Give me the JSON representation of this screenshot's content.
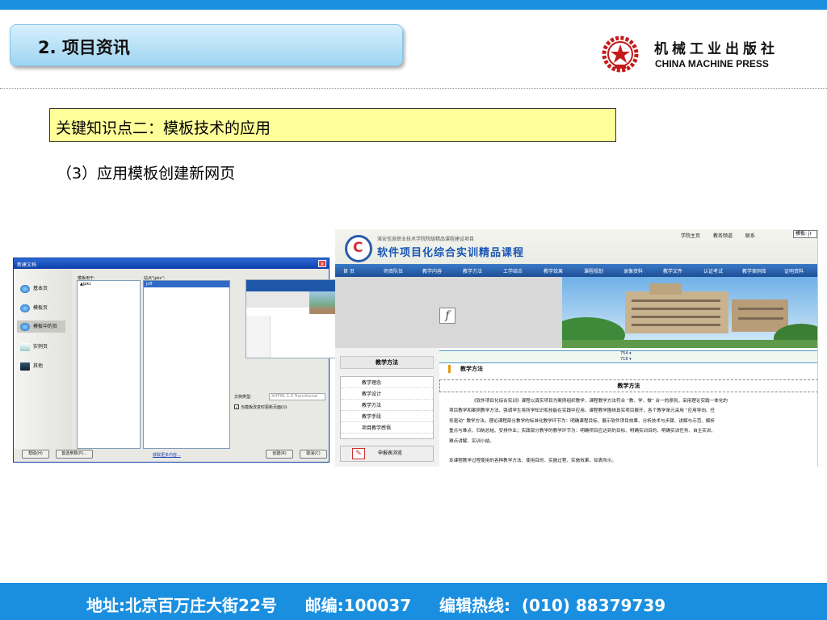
{
  "header": {
    "section_title": "2. 项目资讯",
    "publisher_cn": "机械工业出版社",
    "publisher_en": "CHINA MACHINE PRESS"
  },
  "content": {
    "key_point": "关键知识点二：模板技术的应用",
    "step_title": "（3）应用模板创建新网页"
  },
  "dialog": {
    "title": "新建文档",
    "close": "x",
    "categories": [
      "基本页",
      "模板页",
      "模板中的页",
      "实例页",
      "其他"
    ],
    "selected_category_index": 2,
    "templates_for_label": "模板用于:",
    "templates_for_items": [
      "jpkc"
    ],
    "site_label": "站点\"jpkc\":",
    "site_items": [
      "jcff"
    ],
    "doctype_label": "文档类型:",
    "doctype_value": "XHTML 1.0 Transitional",
    "update_checkbox_label": "当模板改变时更新页面(U)",
    "help_button": "帮助(H)",
    "prefs_button": "首选参数(P)...",
    "more_link": "获取更多内容...",
    "create_button": "创建(R)",
    "cancel_button": "取消(C)"
  },
  "webpage": {
    "org_line": "淮安信息职业技术学院院级精品课程建设项目",
    "course_name": "软件项目化综合实训精品课程",
    "top_links": [
      "学院主页",
      "教务频道",
      "联系"
    ],
    "template_tag": "模板: jr",
    "nav": [
      "首  页",
      "师资队伍",
      "教学内容",
      "教学方法",
      "工学结合",
      "教学效果",
      "课程规划",
      "录像资料",
      "教学文件",
      "认证考试",
      "教学案例库",
      "证明资料"
    ],
    "guide_top": "754 ▾",
    "guide_bottom": "718 ▾",
    "side_title": "教学方法",
    "side_items": [
      "教学理念",
      "教学设计",
      "教学方法",
      "教学手段",
      "项目教学感悟"
    ],
    "apply_label": "申报表浏览",
    "crumb": "教学方法",
    "content_title": "教学方法",
    "paragraph_lines": [
      "《软件项目化综合实训》课程以真实项目为案例组织教学，课程教学方法符合 “教、学、做” 合一的原则，采用理论实践一体化的",
      "项目教学和案例教学方法，强调学生将所学知识和技能在实践中应用。课程教学围绕真实项目展开，各个教学单元采用 “应用导向、任",
      "务驱动” 教学方法。理论课程部分教学的标准化教学环节为：明确课程目标、展示软件项目效果、分析技术与步骤、讲解与示范、解析",
      "重点与难点、归纳总结、安排作业；实践部分教学的教学环节为：明确项目应达到的目标、明确实训目的、明确实训任务、自主实训、",
      "难点讲解、实训小结。"
    ],
    "closing_line": "本课程教学过程使用的各种教学方法、使用目的、实施过程、实施效果，如表所示。"
  },
  "footer": {
    "text": "地址:北京百万庄大街22号     邮编:100037     编辑热线:  (010) 88379739"
  },
  "colors": {
    "accent_blue": "#1a8fe0",
    "key_point_bg": "#ffff99",
    "title_pill_bg": "#b8e2f8"
  }
}
